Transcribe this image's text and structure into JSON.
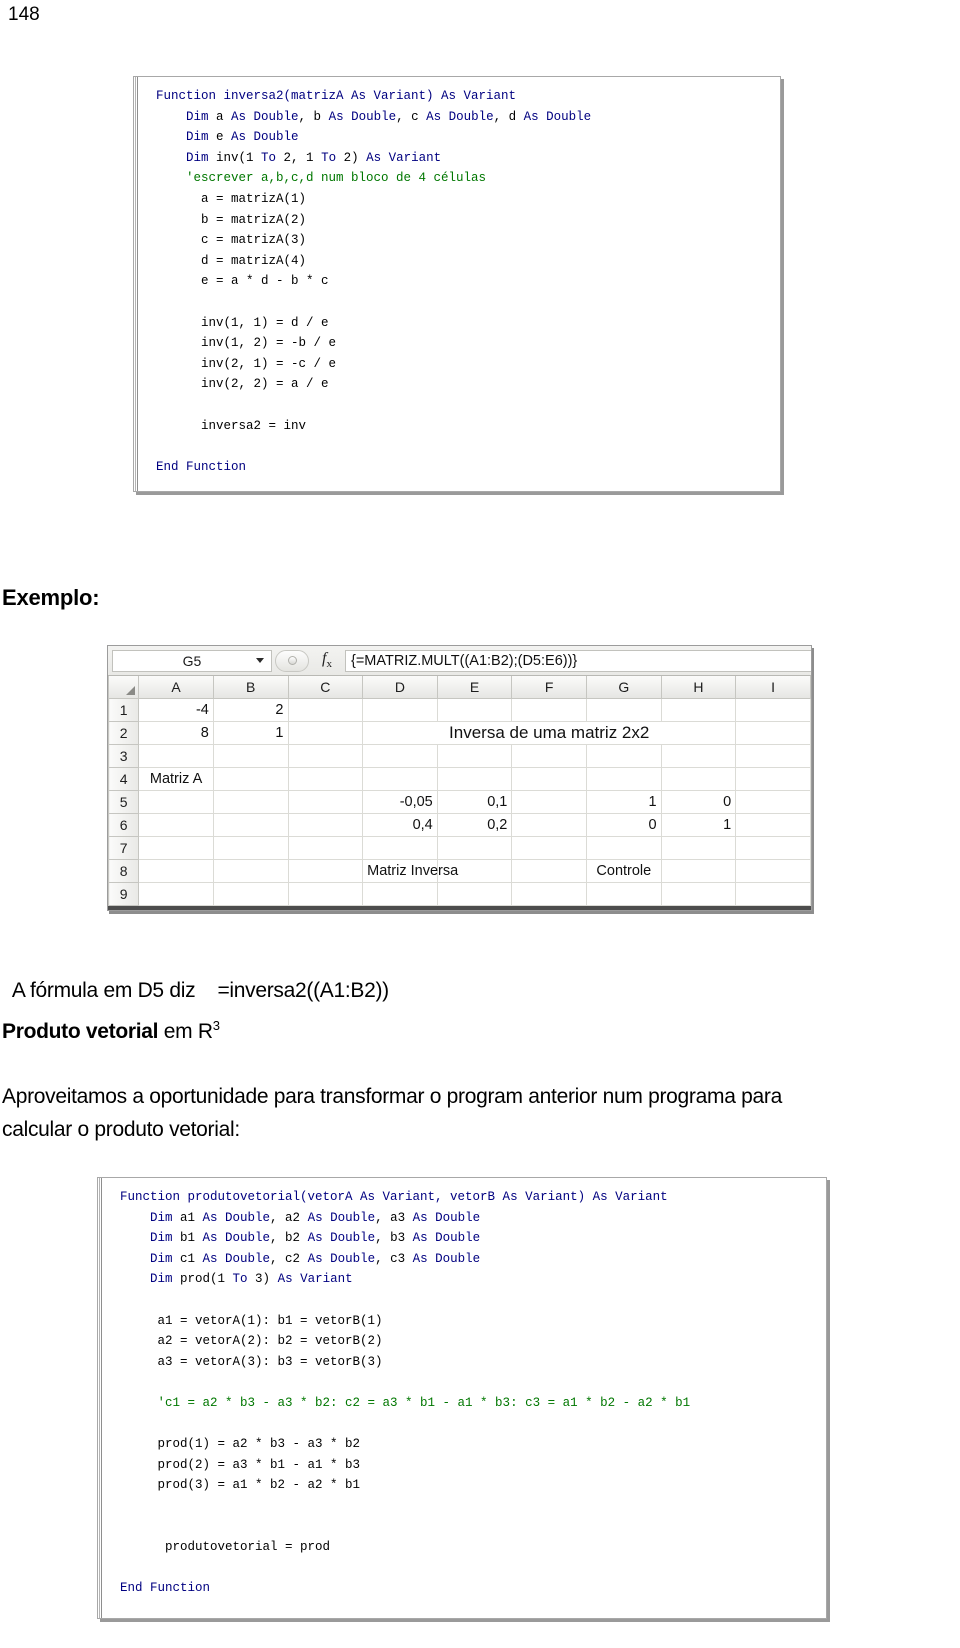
{
  "page": {
    "number": "148"
  },
  "code_block_1": {
    "name": "inversa2-vba-code",
    "lines": [
      [
        {
          "t": "Function inversa2(matrizA As Variant) As Variant",
          "c": "kw"
        }
      ],
      [
        {
          "t": "    Dim",
          "c": "kw"
        },
        {
          "t": " a ",
          "c": "tx"
        },
        {
          "t": "As Double",
          "c": "kw"
        },
        {
          "t": ", b ",
          "c": "tx"
        },
        {
          "t": "As Double",
          "c": "kw"
        },
        {
          "t": ", c ",
          "c": "tx"
        },
        {
          "t": "As Double",
          "c": "kw"
        },
        {
          "t": ", d ",
          "c": "tx"
        },
        {
          "t": "As Double",
          "c": "kw"
        }
      ],
      [
        {
          "t": "    Dim",
          "c": "kw"
        },
        {
          "t": " e ",
          "c": "tx"
        },
        {
          "t": "As Double",
          "c": "kw"
        }
      ],
      [
        {
          "t": "    Dim",
          "c": "kw"
        },
        {
          "t": " inv(1 ",
          "c": "tx"
        },
        {
          "t": "To",
          "c": "kw"
        },
        {
          "t": " 2, 1 ",
          "c": "tx"
        },
        {
          "t": "To",
          "c": "kw"
        },
        {
          "t": " 2) ",
          "c": "tx"
        },
        {
          "t": "As Variant",
          "c": "kw"
        }
      ],
      [
        {
          "t": "    'escrever a,b,c,d num bloco de 4 células",
          "c": "cm"
        }
      ],
      [
        {
          "t": "      a = matrizA(1)",
          "c": "tx"
        }
      ],
      [
        {
          "t": "      b = matrizA(2)",
          "c": "tx"
        }
      ],
      [
        {
          "t": "      c = matrizA(3)",
          "c": "tx"
        }
      ],
      [
        {
          "t": "      d = matrizA(4)",
          "c": "tx"
        }
      ],
      [
        {
          "t": "      e = a * d - b * c",
          "c": "tx"
        }
      ],
      [
        {
          "t": "",
          "c": "tx"
        }
      ],
      [
        {
          "t": "      inv(1, 1) = d / e",
          "c": "tx"
        }
      ],
      [
        {
          "t": "      inv(1, 2) = -b / e",
          "c": "tx"
        }
      ],
      [
        {
          "t": "      inv(2, 1) = -c / e",
          "c": "tx"
        }
      ],
      [
        {
          "t": "      inv(2, 2) = a / e",
          "c": "tx"
        }
      ],
      [
        {
          "t": "",
          "c": "tx"
        }
      ],
      [
        {
          "t": "      inversa2 = inv",
          "c": "tx"
        }
      ],
      [
        {
          "t": "",
          "c": "tx"
        }
      ],
      [
        {
          "t": "End Function",
          "c": "kw"
        }
      ]
    ]
  },
  "exemplo_heading": "Exemplo:",
  "excel": {
    "namebox_value": "G5",
    "formula_value": "{=MATRIZ.MULT((A1:B2);(D5:E6))}",
    "fx_label": "fx",
    "columns": [
      "A",
      "B",
      "C",
      "D",
      "E",
      "F",
      "G",
      "H",
      "I"
    ],
    "rows": [
      "1",
      "2",
      "3",
      "4",
      "5",
      "6",
      "7",
      "8",
      "9"
    ],
    "cells": [
      {
        "row": "1",
        "values": [
          {
            "col": "A",
            "text": "-4",
            "align": "right"
          },
          {
            "col": "B",
            "text": "2",
            "align": "right"
          },
          {
            "col": "C",
            "text": "",
            "align": "right"
          },
          {
            "col": "D",
            "text": "",
            "align": "right"
          },
          {
            "col": "E",
            "text": "",
            "align": "right"
          },
          {
            "col": "F",
            "text": "",
            "align": "right"
          },
          {
            "col": "G",
            "text": "",
            "align": "right"
          },
          {
            "col": "H",
            "text": "",
            "align": "right"
          },
          {
            "col": "I",
            "text": "",
            "align": "right"
          }
        ]
      },
      {
        "row": "2",
        "values": [
          {
            "col": "A",
            "text": "8",
            "align": "right"
          },
          {
            "col": "B",
            "text": "1",
            "align": "right"
          },
          {
            "col": "C",
            "text": "",
            "align": "right"
          },
          {
            "col": "D",
            "text": "Inversa de uma matriz 2x2",
            "align": "merged-title"
          },
          {
            "col": "E",
            "text": "",
            "align": "right"
          },
          {
            "col": "F",
            "text": "",
            "align": "right"
          },
          {
            "col": "G",
            "text": "",
            "align": "right"
          },
          {
            "col": "H",
            "text": "",
            "align": "right"
          },
          {
            "col": "I",
            "text": "",
            "align": "right"
          }
        ]
      },
      {
        "row": "3",
        "values": [
          {
            "col": "A",
            "text": "",
            "align": "right"
          },
          {
            "col": "B",
            "text": "",
            "align": "right"
          },
          {
            "col": "C",
            "text": "",
            "align": "right"
          },
          {
            "col": "D",
            "text": "",
            "align": "right"
          },
          {
            "col": "E",
            "text": "",
            "align": "right"
          },
          {
            "col": "F",
            "text": "",
            "align": "right"
          },
          {
            "col": "G",
            "text": "",
            "align": "right"
          },
          {
            "col": "H",
            "text": "",
            "align": "right"
          },
          {
            "col": "I",
            "text": "",
            "align": "right"
          }
        ]
      },
      {
        "row": "4",
        "values": [
          {
            "col": "A",
            "text": "Matriz A",
            "align": "center"
          },
          {
            "col": "B",
            "text": "",
            "align": "right"
          },
          {
            "col": "C",
            "text": "",
            "align": "right"
          },
          {
            "col": "D",
            "text": "",
            "align": "right"
          },
          {
            "col": "E",
            "text": "",
            "align": "right"
          },
          {
            "col": "F",
            "text": "",
            "align": "right"
          },
          {
            "col": "G",
            "text": "",
            "align": "right"
          },
          {
            "col": "H",
            "text": "",
            "align": "right"
          },
          {
            "col": "I",
            "text": "",
            "align": "right"
          }
        ]
      },
      {
        "row": "5",
        "values": [
          {
            "col": "A",
            "text": "",
            "align": "right"
          },
          {
            "col": "B",
            "text": "",
            "align": "right"
          },
          {
            "col": "C",
            "text": "",
            "align": "right"
          },
          {
            "col": "D",
            "text": "-0,05",
            "align": "right"
          },
          {
            "col": "E",
            "text": "0,1",
            "align": "right"
          },
          {
            "col": "F",
            "text": "",
            "align": "right"
          },
          {
            "col": "G",
            "text": "1",
            "align": "right"
          },
          {
            "col": "H",
            "text": "0",
            "align": "right"
          },
          {
            "col": "I",
            "text": "",
            "align": "right"
          }
        ]
      },
      {
        "row": "6",
        "values": [
          {
            "col": "A",
            "text": "",
            "align": "right"
          },
          {
            "col": "B",
            "text": "",
            "align": "right"
          },
          {
            "col": "C",
            "text": "",
            "align": "right"
          },
          {
            "col": "D",
            "text": "0,4",
            "align": "right"
          },
          {
            "col": "E",
            "text": "0,2",
            "align": "right"
          },
          {
            "col": "F",
            "text": "",
            "align": "right"
          },
          {
            "col": "G",
            "text": "0",
            "align": "right"
          },
          {
            "col": "H",
            "text": "1",
            "align": "right"
          },
          {
            "col": "I",
            "text": "",
            "align": "right"
          }
        ]
      },
      {
        "row": "7",
        "values": [
          {
            "col": "A",
            "text": "",
            "align": "right"
          },
          {
            "col": "B",
            "text": "",
            "align": "right"
          },
          {
            "col": "C",
            "text": "",
            "align": "right"
          },
          {
            "col": "D",
            "text": "",
            "align": "right"
          },
          {
            "col": "E",
            "text": "",
            "align": "right"
          },
          {
            "col": "F",
            "text": "",
            "align": "right"
          },
          {
            "col": "G",
            "text": "",
            "align": "right"
          },
          {
            "col": "H",
            "text": "",
            "align": "right"
          },
          {
            "col": "I",
            "text": "",
            "align": "right"
          }
        ]
      },
      {
        "row": "8",
        "values": [
          {
            "col": "A",
            "text": "",
            "align": "right"
          },
          {
            "col": "B",
            "text": "",
            "align": "right"
          },
          {
            "col": "C",
            "text": "",
            "align": "right"
          },
          {
            "col": "D",
            "text": "Matriz Inversa",
            "align": "center"
          },
          {
            "col": "E",
            "text": "",
            "align": "right"
          },
          {
            "col": "F",
            "text": "",
            "align": "right"
          },
          {
            "col": "G",
            "text": "Controle",
            "align": "center"
          },
          {
            "col": "H",
            "text": "",
            "align": "right"
          },
          {
            "col": "I",
            "text": "",
            "align": "right"
          }
        ]
      },
      {
        "row": "9",
        "values": [
          {
            "col": "A",
            "text": "",
            "align": "right"
          },
          {
            "col": "B",
            "text": "",
            "align": "right"
          },
          {
            "col": "C",
            "text": "",
            "align": "right"
          },
          {
            "col": "D",
            "text": "",
            "align": "right"
          },
          {
            "col": "E",
            "text": "",
            "align": "right"
          },
          {
            "col": "F",
            "text": "",
            "align": "right"
          },
          {
            "col": "G",
            "text": "",
            "align": "right"
          },
          {
            "col": "H",
            "text": "",
            "align": "right"
          },
          {
            "col": "I",
            "text": "",
            "align": "right"
          }
        ]
      }
    ]
  },
  "formula_note": {
    "prefix": "A fórmula em D5 diz",
    "formula": "=inversa2((A1:B2))"
  },
  "section_heading": {
    "bold_part": "Produto vetorial",
    "rest": " em R",
    "superscript": "3"
  },
  "paragraph": "Aproveitamos a oportunidade para transformar o program anterior num programa para calcular o produto vetorial:",
  "code_block_2": {
    "name": "produtovetorial-vba-code",
    "lines": [
      [
        {
          "t": "Function produtovetorial(vetorA As Variant, vetorB As Variant) As Variant",
          "c": "kw"
        }
      ],
      [
        {
          "t": "    Dim",
          "c": "kw"
        },
        {
          "t": " a1 ",
          "c": "tx"
        },
        {
          "t": "As Double",
          "c": "kw"
        },
        {
          "t": ", a2 ",
          "c": "tx"
        },
        {
          "t": "As Double",
          "c": "kw"
        },
        {
          "t": ", a3 ",
          "c": "tx"
        },
        {
          "t": "As Double",
          "c": "kw"
        }
      ],
      [
        {
          "t": "    Dim",
          "c": "kw"
        },
        {
          "t": " b1 ",
          "c": "tx"
        },
        {
          "t": "As Double",
          "c": "kw"
        },
        {
          "t": ", b2 ",
          "c": "tx"
        },
        {
          "t": "As Double",
          "c": "kw"
        },
        {
          "t": ", b3 ",
          "c": "tx"
        },
        {
          "t": "As Double",
          "c": "kw"
        }
      ],
      [
        {
          "t": "    Dim",
          "c": "kw"
        },
        {
          "t": " c1 ",
          "c": "tx"
        },
        {
          "t": "As Double",
          "c": "kw"
        },
        {
          "t": ", c2 ",
          "c": "tx"
        },
        {
          "t": "As Double",
          "c": "kw"
        },
        {
          "t": ", c3 ",
          "c": "tx"
        },
        {
          "t": "As Double",
          "c": "kw"
        }
      ],
      [
        {
          "t": "    Dim",
          "c": "kw"
        },
        {
          "t": " prod(1 ",
          "c": "tx"
        },
        {
          "t": "To",
          "c": "kw"
        },
        {
          "t": " 3) ",
          "c": "tx"
        },
        {
          "t": "As Variant",
          "c": "kw"
        }
      ],
      [
        {
          "t": "",
          "c": "tx"
        }
      ],
      [
        {
          "t": "     a1 = vetorA(1): b1 = vetorB(1)",
          "c": "tx"
        }
      ],
      [
        {
          "t": "     a2 = vetorA(2): b2 = vetorB(2)",
          "c": "tx"
        }
      ],
      [
        {
          "t": "     a3 = vetorA(3): b3 = vetorB(3)",
          "c": "tx"
        }
      ],
      [
        {
          "t": "",
          "c": "tx"
        }
      ],
      [
        {
          "t": "     'c1 = a2 * b3 - a3 * b2: c2 = a3 * b1 - a1 * b3: c3 = a1 * b2 - a2 * b1",
          "c": "cm"
        }
      ],
      [
        {
          "t": "",
          "c": "tx"
        }
      ],
      [
        {
          "t": "     prod(1) = a2 * b3 - a3 * b2",
          "c": "tx"
        }
      ],
      [
        {
          "t": "     prod(2) = a3 * b1 - a1 * b3",
          "c": "tx"
        }
      ],
      [
        {
          "t": "     prod(3) = a1 * b2 - a2 * b1",
          "c": "tx"
        }
      ],
      [
        {
          "t": "",
          "c": "tx"
        }
      ],
      [
        {
          "t": "",
          "c": "tx"
        }
      ],
      [
        {
          "t": "      produtovetorial = prod",
          "c": "tx"
        }
      ],
      [
        {
          "t": "",
          "c": "tx"
        }
      ],
      [
        {
          "t": "End Function",
          "c": "kw"
        }
      ]
    ]
  }
}
